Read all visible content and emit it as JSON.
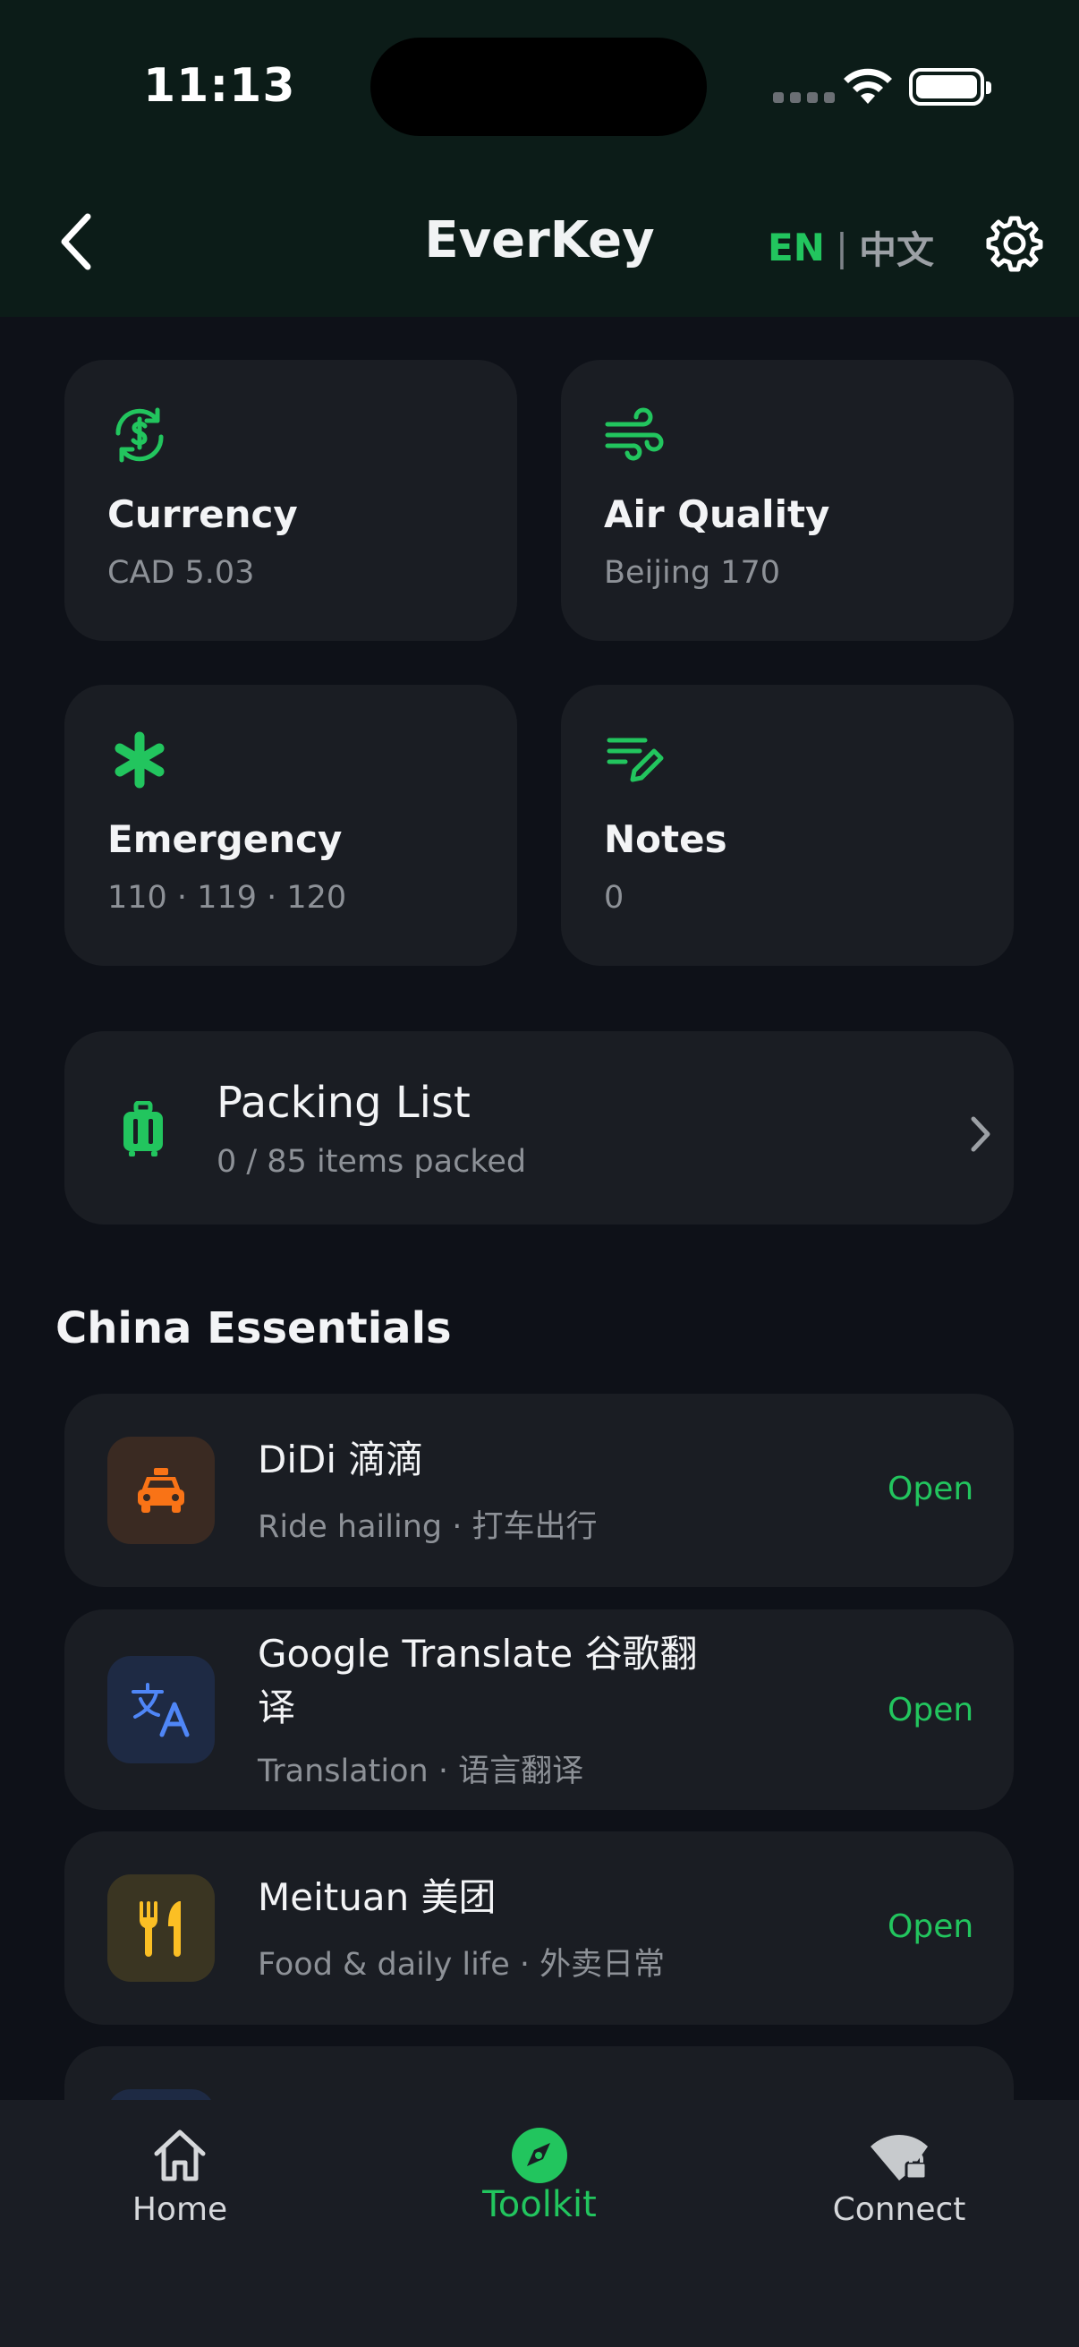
{
  "status_bar": {
    "time": "11:13"
  },
  "header": {
    "title": "EverKey",
    "lang_en": "EN",
    "lang_separator": "|",
    "lang_zh": "中文",
    "back_icon": "chevron-left-icon",
    "settings_icon": "gear-icon"
  },
  "tiles": [
    {
      "title": "Currency",
      "subtitle": "CAD 5.03",
      "icon": "currency-exchange-icon"
    },
    {
      "title": "Air Quality",
      "subtitle": "Beijing 170",
      "icon": "wind-icon"
    },
    {
      "title": "Emergency",
      "subtitle": "110 · 119 · 120",
      "icon": "asterisk-icon"
    },
    {
      "title": "Notes",
      "subtitle": "0",
      "icon": "note-edit-icon"
    }
  ],
  "packing": {
    "title": "Packing List",
    "subtitle": "0 / 85 items packed",
    "icon": "luggage-icon"
  },
  "section": {
    "title": "China Essentials"
  },
  "apps": [
    {
      "name": "DiDi 滴滴",
      "subtitle": "Ride hailing · 打车出行",
      "action": "Open",
      "icon": "taxi-icon",
      "icon_bg": "#3a2a22",
      "icon_color": "#f97316"
    },
    {
      "name_line1": "Google Translate 谷歌翻",
      "name_line2": "译",
      "subtitle": "Translation · 语言翻译",
      "action": "Open",
      "icon": "translate-icon",
      "icon_bg": "#1e2a44",
      "icon_color": "#4f86f7"
    },
    {
      "name": "Meituan 美团",
      "subtitle": "Food & daily life · 外卖日常",
      "action": "Open",
      "icon": "utensils-icon",
      "icon_bg": "#3a3522",
      "icon_color": "#fbbf24"
    }
  ],
  "tabs": [
    {
      "label": "Home",
      "icon": "home-icon",
      "active": false
    },
    {
      "label": "Toolkit",
      "icon": "compass-icon",
      "active": true
    },
    {
      "label": "Connect",
      "icon": "wifi-lock-icon",
      "active": false
    }
  ],
  "colors": {
    "accent": "#22c55e",
    "card": "#1a1d23",
    "background": "#0e1118",
    "header": "#0c1c18"
  }
}
